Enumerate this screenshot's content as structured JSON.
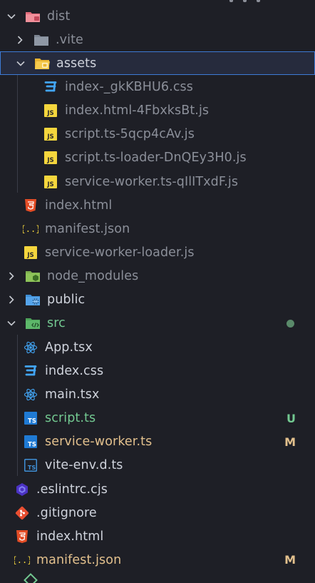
{
  "colors": {
    "background": "#1e1f26",
    "selection_bg": "#262b3d",
    "selection_border": "#3d7bd6",
    "text": "#cfd3dc",
    "text_dim": "#8b8f99",
    "git_untracked": "#73c991",
    "git_modified": "#e2c08d",
    "git_dot": "#5a8a6a"
  },
  "tree": [
    {
      "label": "dist",
      "type": "folder",
      "expanded": true,
      "icon": "folder-dist-icon",
      "dim": true
    },
    {
      "label": ".vite",
      "type": "folder",
      "expanded": false,
      "icon": "folder-icon",
      "dim": true
    },
    {
      "label": "assets",
      "type": "folder",
      "expanded": true,
      "icon": "folder-assets-icon",
      "selected": true
    },
    {
      "label": "index-_gkKBHU6.css",
      "type": "file",
      "icon": "css-icon",
      "dim": true
    },
    {
      "label": "index.html-4FbxksBt.js",
      "type": "file",
      "icon": "js-icon",
      "dim": true
    },
    {
      "label": "script.ts-5qcp4cAv.js",
      "type": "file",
      "icon": "js-icon",
      "dim": true
    },
    {
      "label": "script.ts-loader-DnQEy3H0.js",
      "type": "file",
      "icon": "js-icon",
      "dim": true
    },
    {
      "label": "service-worker.ts-qIlITxdF.js",
      "type": "file",
      "icon": "js-icon",
      "dim": true
    },
    {
      "label": "index.html",
      "type": "file",
      "icon": "html-icon",
      "dim": true
    },
    {
      "label": "manifest.json",
      "type": "file",
      "icon": "json-icon",
      "dim": true
    },
    {
      "label": "service-worker-loader.js",
      "type": "file",
      "icon": "js-icon",
      "dim": true
    },
    {
      "label": "node_modules",
      "type": "folder",
      "expanded": false,
      "icon": "folder-node-icon",
      "dim": true
    },
    {
      "label": "public",
      "type": "folder",
      "expanded": false,
      "icon": "folder-public-icon"
    },
    {
      "label": "src",
      "type": "folder",
      "expanded": true,
      "icon": "folder-src-icon",
      "status": "green",
      "git": "dot"
    },
    {
      "label": "App.tsx",
      "type": "file",
      "icon": "react-icon"
    },
    {
      "label": "index.css",
      "type": "file",
      "icon": "css-icon"
    },
    {
      "label": "main.tsx",
      "type": "file",
      "icon": "react-icon"
    },
    {
      "label": "script.ts",
      "type": "file",
      "icon": "ts-icon",
      "status": "green",
      "git": "U"
    },
    {
      "label": "service-worker.ts",
      "type": "file",
      "icon": "ts-icon",
      "status": "orange",
      "git": "M"
    },
    {
      "label": "vite-env.d.ts",
      "type": "file",
      "icon": "ts-def-icon"
    },
    {
      "label": ".eslintrc.cjs",
      "type": "file",
      "icon": "eslint-icon"
    },
    {
      "label": ".gitignore",
      "type": "file",
      "icon": "git-icon"
    },
    {
      "label": "index.html",
      "type": "file",
      "icon": "html-icon"
    },
    {
      "label": "manifest.json",
      "type": "file",
      "icon": "json-icon",
      "status": "orange",
      "git": "M"
    }
  ]
}
